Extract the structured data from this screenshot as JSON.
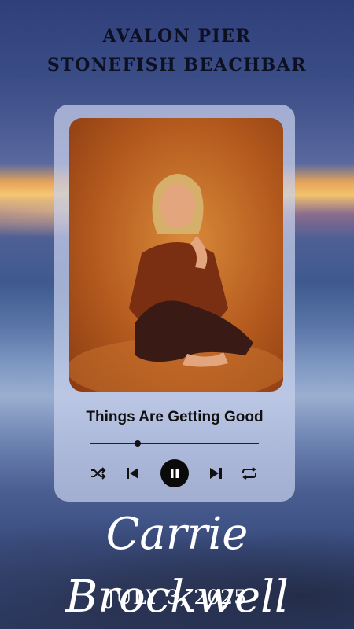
{
  "venue": {
    "line1": "AVALON PIER",
    "line2": "STONEFISH BEACHBAR"
  },
  "player": {
    "song_title": "Things Are Getting Good",
    "progress_fraction": 0.28,
    "controls": [
      "shuffle-icon",
      "previous-icon",
      "pause-icon",
      "next-icon",
      "repeat-icon"
    ]
  },
  "artist": "Carrie Brockwell",
  "date": "JULY 3, 2025"
}
